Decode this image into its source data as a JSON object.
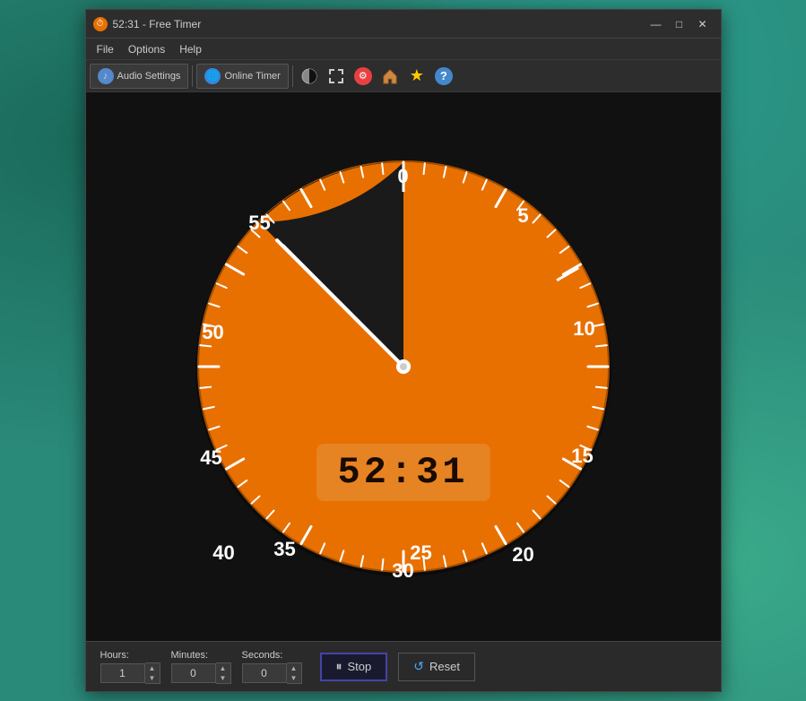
{
  "window": {
    "title": "52:31 - Free Timer",
    "icon": "⏱"
  },
  "title_controls": {
    "minimize": "—",
    "maximize": "□",
    "close": "✕"
  },
  "menu": {
    "items": [
      "File",
      "Options",
      "Help"
    ]
  },
  "toolbar": {
    "audio_settings": "Audio Settings",
    "online_timer": "Online Timer"
  },
  "clock": {
    "labels": [
      {
        "value": "0",
        "angle": 0
      },
      {
        "value": "5",
        "angle": 30
      },
      {
        "value": "10",
        "angle": 60
      },
      {
        "value": "15",
        "angle": 90
      },
      {
        "value": "20",
        "angle": 120
      },
      {
        "value": "25",
        "angle": 150
      },
      {
        "value": "30",
        "angle": 180
      },
      {
        "value": "35",
        "angle": 210
      },
      {
        "value": "40",
        "angle": 240
      },
      {
        "value": "45",
        "angle": 270
      },
      {
        "value": "50",
        "angle": 300
      },
      {
        "value": "55",
        "angle": 330
      }
    ],
    "time_display": "52:31",
    "current_seconds": 3151,
    "total_seconds": 3600
  },
  "controls": {
    "hours_label": "Hours:",
    "hours_value": "1",
    "minutes_label": "Minutes:",
    "minutes_value": "0",
    "seconds_label": "Seconds:",
    "seconds_value": "0",
    "stop_label": "Stop",
    "reset_label": "Reset"
  }
}
